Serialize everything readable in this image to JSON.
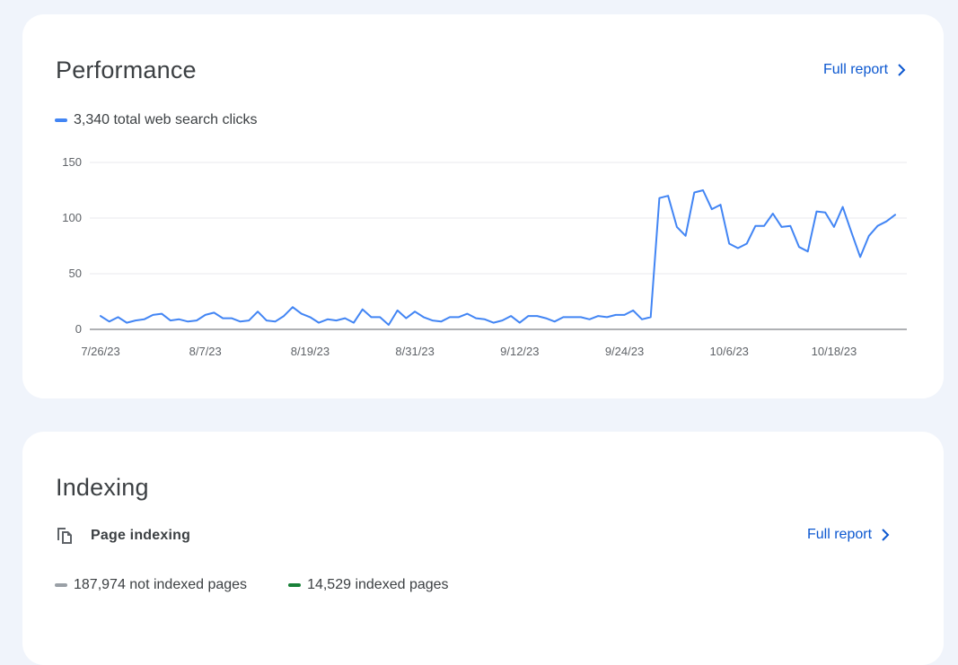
{
  "performance": {
    "title": "Performance",
    "full_report_label": "Full report",
    "legend_label": "3,340 total web search clicks",
    "series_color": "#4285f4"
  },
  "indexing": {
    "title": "Indexing",
    "section_label": "Page indexing",
    "full_report_label": "Full report",
    "legends": [
      {
        "label": "187,974 not indexed pages",
        "color": "#9aa0a6"
      },
      {
        "label": "14,529 indexed pages",
        "color": "#188038"
      }
    ]
  },
  "chart_data": {
    "type": "line",
    "title": "",
    "xlabel": "",
    "ylabel": "",
    "ylim": [
      0,
      150
    ],
    "yticks": [
      0,
      50,
      100,
      150
    ],
    "grid": true,
    "legend_placement": "top-left",
    "x_tick_labels": [
      "7/26/23",
      "8/7/23",
      "8/19/23",
      "8/31/23",
      "9/12/23",
      "9/24/23",
      "10/6/23",
      "10/18/23"
    ],
    "x_tick_index": [
      0,
      12,
      24,
      36,
      48,
      60,
      72,
      84
    ],
    "series": [
      {
        "name": "3,340 total web search clicks",
        "color": "#4285f4",
        "values": [
          12,
          7,
          11,
          6,
          8,
          9,
          13,
          14,
          8,
          9,
          7,
          8,
          13,
          15,
          10,
          10,
          7,
          8,
          16,
          8,
          7,
          12,
          20,
          14,
          11,
          6,
          9,
          8,
          10,
          6,
          18,
          11,
          11,
          4,
          17,
          10,
          16,
          11,
          8,
          7,
          11,
          11,
          14,
          10,
          9,
          6,
          8,
          12,
          6,
          12,
          12,
          10,
          7,
          11,
          11,
          11,
          9,
          12,
          11,
          13,
          13,
          17,
          9,
          11,
          118,
          120,
          92,
          84,
          123,
          125,
          108,
          112,
          77,
          73,
          77,
          93,
          93,
          104,
          92,
          93,
          74,
          70,
          106,
          105,
          92,
          110,
          87,
          65,
          84,
          93,
          97,
          103
        ]
      }
    ]
  }
}
